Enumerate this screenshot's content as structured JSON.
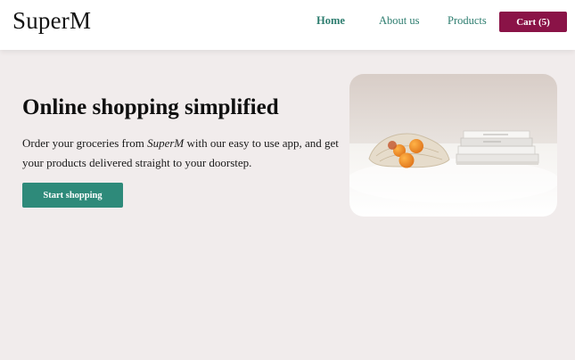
{
  "brand": {
    "logo": "SuperM"
  },
  "nav": {
    "home": "Home",
    "about": "About us",
    "products": "Products",
    "cart": "Cart (5)"
  },
  "hero": {
    "title": "Online shopping simplified",
    "text_before": "Order your groceries from ",
    "text_brand": "SuperM",
    "text_after": " with our easy to use app, and get your products delivered straight to your doorstep.",
    "cta": "Start shopping"
  },
  "colors": {
    "accent": "#2d7d6f",
    "cart": "#8a1347",
    "cta": "#2e8a7a",
    "background": "#f1ecec"
  },
  "icons": {
    "hero_image": "groceries-photo"
  }
}
